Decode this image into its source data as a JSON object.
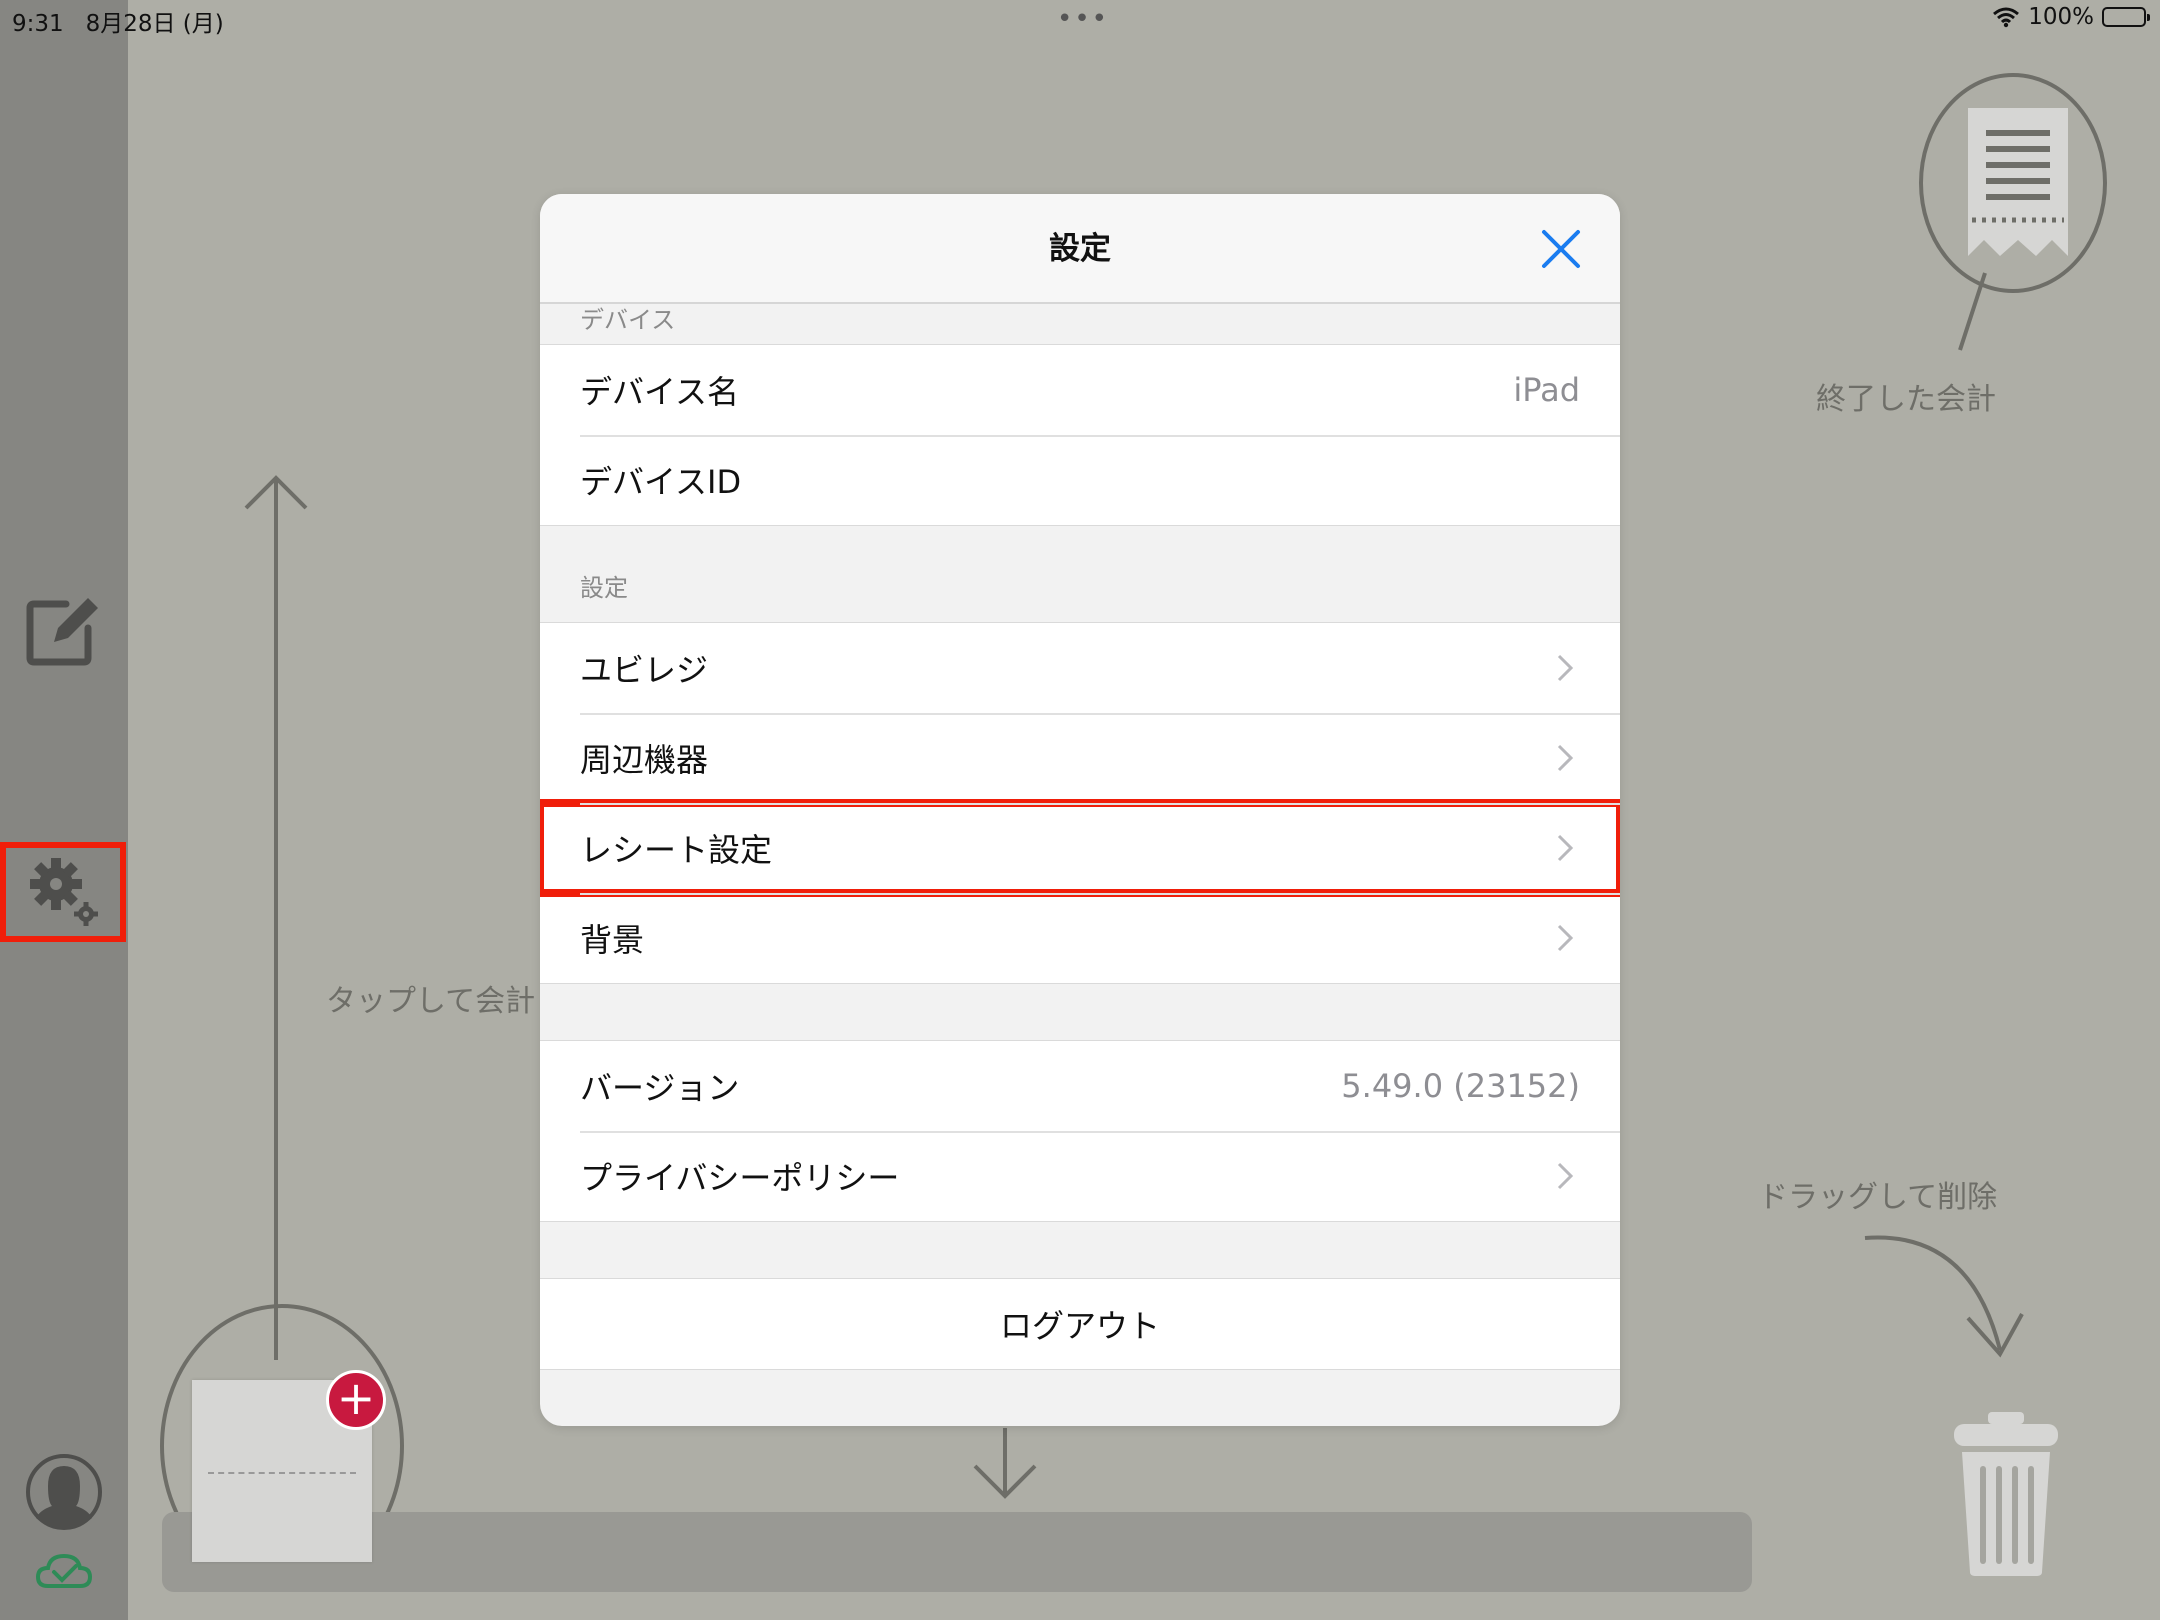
{
  "status_bar": {
    "time": "9:31",
    "date": "8月28日 (月)",
    "dots": "•••",
    "battery_text": "100%"
  },
  "background": {
    "labels": {
      "finished_accounts": "終了した会計",
      "tap_to_account": "タップして会計",
      "drag_to_delete": "ドラッグして削除"
    }
  },
  "modal": {
    "title": "設定",
    "sections": {
      "device": {
        "header": "デバイス",
        "rows": [
          {
            "label": "デバイス名",
            "value": "iPad"
          },
          {
            "label": "デバイスID",
            "value": ""
          }
        ]
      },
      "settings": {
        "header": "設定",
        "rows": [
          {
            "label": "ユビレジ"
          },
          {
            "label": "周辺機器"
          },
          {
            "label": "レシート設定"
          },
          {
            "label": "背景"
          }
        ]
      },
      "about": {
        "rows": [
          {
            "label": "バージョン",
            "value": "5.49.0 (23152)"
          },
          {
            "label": "プライバシーポリシー"
          }
        ]
      },
      "logout": {
        "label": "ログアウト"
      }
    }
  },
  "colors": {
    "accent_blue": "#1a7cf0",
    "highlight_red": "#f01e0a",
    "add_button_red": "#c8193f",
    "sync_green": "#2e8b57"
  },
  "icons": [
    "wifi-icon",
    "battery-icon",
    "edit-icon",
    "gear-icon",
    "avatar-icon",
    "cloud-check-icon",
    "close-icon",
    "chevron-right-icon",
    "receipt-icon",
    "trash-icon",
    "plus-icon"
  ]
}
